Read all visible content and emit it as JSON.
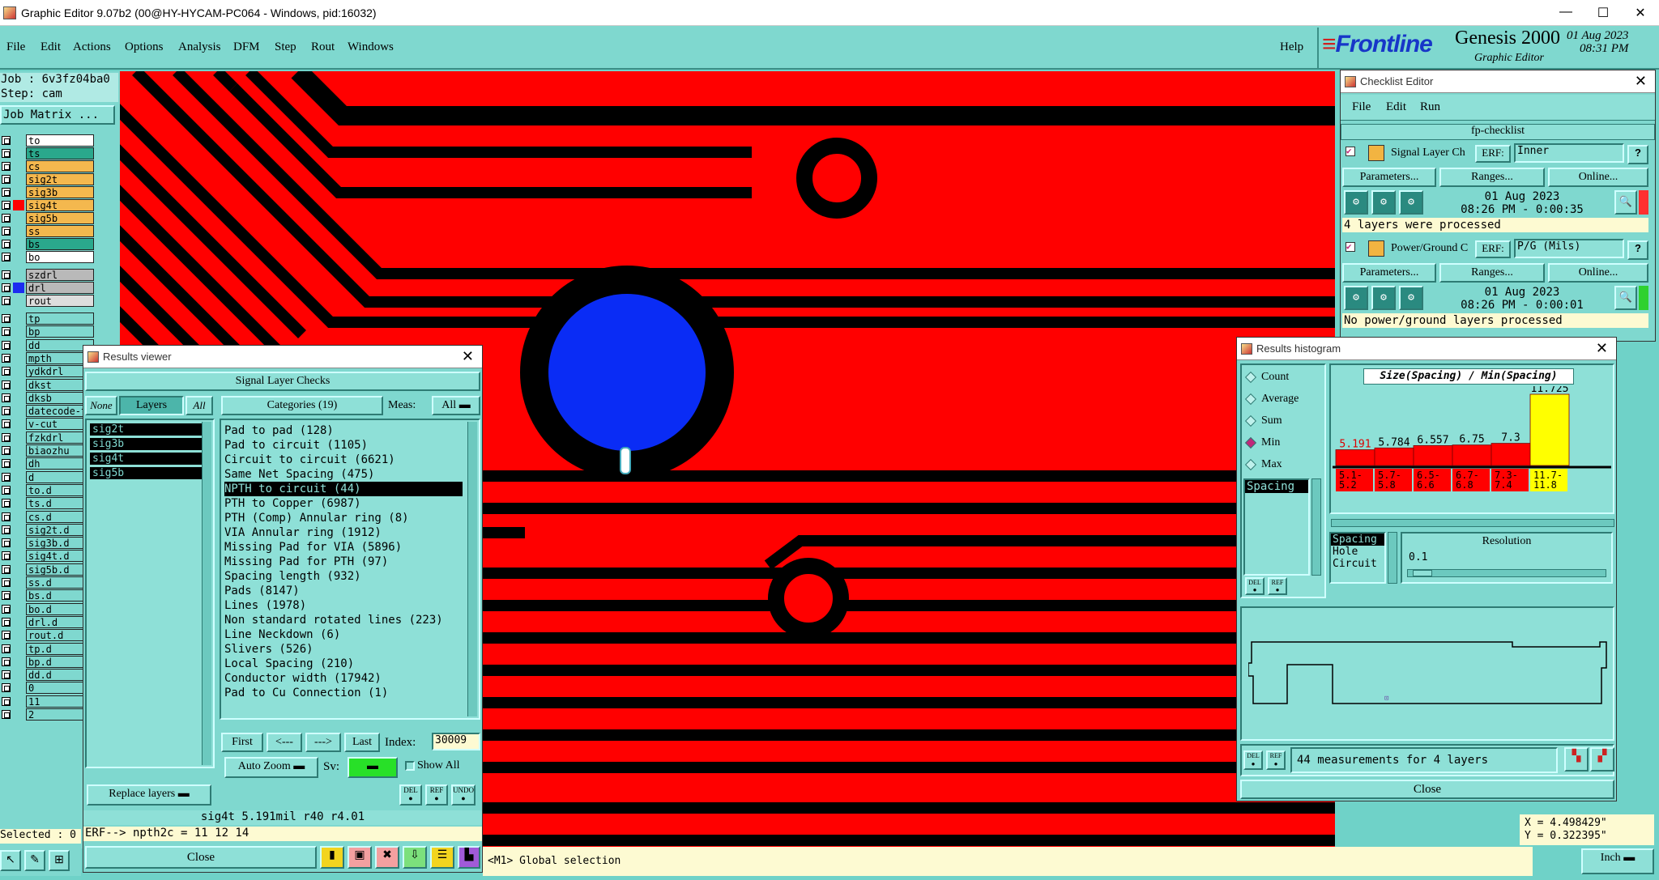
{
  "window": {
    "title": "Graphic Editor 9.07b2 (00@HY-HYCAM-PC064 - Windows, pid:16032)"
  },
  "menu": [
    "File",
    "Edit",
    "Actions",
    "Options",
    "Analysis",
    "DFM",
    "Step",
    "Rout",
    "Windows"
  ],
  "help": "Help",
  "brand": {
    "logo": "Frontline",
    "product": "Genesis 2000",
    "subtitle": "Graphic Editor",
    "date": "01 Aug 2023",
    "time": "08:31 PM"
  },
  "job": {
    "job": "Job : 6v3fz04ba0",
    "step": "Step: cam",
    "matrix": "Job Matrix ..."
  },
  "layers": [
    {
      "name": "to",
      "color": "#ffffff",
      "swatch": "#7fd8cf"
    },
    {
      "name": "ts",
      "color": "#2aa88c",
      "swatch": "#7fd8cf"
    },
    {
      "name": "cs",
      "color": "#f4b84e",
      "swatch": "#7fd8cf"
    },
    {
      "name": "sig2t",
      "color": "#f4b84e",
      "swatch": "#7fd8cf"
    },
    {
      "name": "sig3b",
      "color": "#f4b84e",
      "swatch": "#7fd8cf"
    },
    {
      "name": "sig4t",
      "color": "#f4b84e",
      "swatch": "#ff0000"
    },
    {
      "name": "sig5b",
      "color": "#f4b84e",
      "swatch": "#7fd8cf"
    },
    {
      "name": "ss",
      "color": "#f4b84e",
      "swatch": "#7fd8cf"
    },
    {
      "name": "bs",
      "color": "#2aa88c",
      "swatch": "#7fd8cf"
    },
    {
      "name": "bo",
      "color": "#ffffff",
      "swatch": "#7fd8cf"
    },
    {
      "name": "szdrl",
      "color": "#b9b9b9",
      "swatch": "#7fd8cf"
    },
    {
      "name": "drl",
      "color": "#b9b9b9",
      "swatch": "#1c2cf0"
    },
    {
      "name": "rout",
      "color": "#dddddd",
      "swatch": "#7fd8cf"
    },
    {
      "name": "tp",
      "color": "#7fd8cf",
      "swatch": "#7fd8cf"
    },
    {
      "name": "bp",
      "color": "#7fd8cf",
      "swatch": "#7fd8cf"
    },
    {
      "name": "dd",
      "color": "#7fd8cf",
      "swatch": "#7fd8cf"
    },
    {
      "name": "mpth",
      "color": "#7fd8cf",
      "swatch": "#7fd8cf"
    },
    {
      "name": "ydkdrl",
      "color": "#7fd8cf",
      "swatch": "#7fd8cf"
    },
    {
      "name": "dkst",
      "color": "#7fd8cf",
      "swatch": "#7fd8cf"
    },
    {
      "name": "dksb",
      "color": "#7fd8cf",
      "swatch": "#7fd8cf"
    },
    {
      "name": "datecode-t",
      "color": "#7fd8cf",
      "swatch": "#7fd8cf"
    },
    {
      "name": "v-cut",
      "color": "#7fd8cf",
      "swatch": "#7fd8cf"
    },
    {
      "name": "fzkdrl",
      "color": "#7fd8cf",
      "swatch": "#7fd8cf"
    },
    {
      "name": "biaozhu",
      "color": "#7fd8cf",
      "swatch": "#7fd8cf"
    },
    {
      "name": "dh",
      "color": "#7fd8cf",
      "swatch": "#7fd8cf"
    },
    {
      "name": "d",
      "color": "#7fd8cf",
      "swatch": "#7fd8cf"
    },
    {
      "name": "to.d",
      "color": "#7fd8cf",
      "swatch": "#7fd8cf"
    },
    {
      "name": "ts.d",
      "color": "#7fd8cf",
      "swatch": "#7fd8cf"
    },
    {
      "name": "cs.d",
      "color": "#7fd8cf",
      "swatch": "#7fd8cf"
    },
    {
      "name": "sig2t.d",
      "color": "#7fd8cf",
      "swatch": "#7fd8cf"
    },
    {
      "name": "sig3b.d",
      "color": "#7fd8cf",
      "swatch": "#7fd8cf"
    },
    {
      "name": "sig4t.d",
      "color": "#7fd8cf",
      "swatch": "#7fd8cf"
    },
    {
      "name": "sig5b.d",
      "color": "#7fd8cf",
      "swatch": "#7fd8cf"
    },
    {
      "name": "ss.d",
      "color": "#7fd8cf",
      "swatch": "#7fd8cf"
    },
    {
      "name": "bs.d",
      "color": "#7fd8cf",
      "swatch": "#7fd8cf"
    },
    {
      "name": "bo.d",
      "color": "#7fd8cf",
      "swatch": "#7fd8cf"
    },
    {
      "name": "drl.d",
      "color": "#7fd8cf",
      "swatch": "#7fd8cf"
    },
    {
      "name": "rout.d",
      "color": "#7fd8cf",
      "swatch": "#7fd8cf"
    },
    {
      "name": "tp.d",
      "color": "#7fd8cf",
      "swatch": "#7fd8cf"
    },
    {
      "name": "bp.d",
      "color": "#7fd8cf",
      "swatch": "#7fd8cf"
    },
    {
      "name": "dd.d",
      "color": "#7fd8cf",
      "swatch": "#7fd8cf"
    },
    {
      "name": "0",
      "color": "#7fd8cf",
      "swatch": "#7fd8cf"
    },
    {
      "name": "11",
      "color": "#7fd8cf",
      "swatch": "#7fd8cf"
    },
    {
      "name": "2",
      "color": "#7fd8cf",
      "swatch": "#7fd8cf"
    }
  ],
  "selected": "Selected : 0",
  "results_viewer": {
    "title": "Results viewer",
    "header": "Signal Layer Checks",
    "none": "None",
    "layers": "Layers",
    "all": "All",
    "categories_btn": "Categories (19)",
    "meas_label": "Meas:",
    "meas_value": "All",
    "layer_list": [
      "sig2t",
      "sig3b",
      "sig4t",
      "sig5b"
    ],
    "categories": [
      "Pad to pad (128)",
      "Pad to circuit (1105)",
      "Circuit to circuit (6621)",
      "Same Net Spacing (475)",
      "NPTH to circuit (44)",
      "PTH to Copper (6987)",
      "PTH (Comp) Annular ring (8)",
      "VIA Annular ring (1912)",
      "Missing Pad for VIA (5896)",
      "Missing Pad for PTH (97)",
      "Spacing length (932)",
      "Pads (8147)",
      "Lines (1978)",
      "Non standard rotated lines (223)",
      "Line Neckdown (6)",
      "Slivers (526)",
      "Local Spacing (210)",
      "Conductor width (17942)",
      "Pad to Cu Connection (1)"
    ],
    "selected_category": 4,
    "first": "First",
    "prev": "<---",
    "next": "--->",
    "last": "Last",
    "index_label": "Index:",
    "index_value": "30009",
    "auto_zoom": "Auto Zoom",
    "sv_label": "Sv:",
    "show_all": "Show All",
    "replace_layers": "Replace layers",
    "del": "DEL",
    "ref": "REF",
    "undo": "UNDO",
    "info": "sig4t 5.191mil  r40  r4.01",
    "erf": "ERF--> npth2c = 11 12 14",
    "close": "Close"
  },
  "checklist_editor": {
    "title": "Checklist Editor",
    "menu": [
      "File",
      "Edit",
      "Run"
    ],
    "name": "fp-checklist",
    "checks": [
      {
        "title": "Signal Layer Ch",
        "erf": "ERF:",
        "erf_value": "Inner",
        "date": "01 Aug 2023",
        "time": "08:26 PM - 0:00:35",
        "status": "4 layers were processed",
        "status_color": "#ff3030"
      },
      {
        "title": "Power/Ground C",
        "erf": "ERF:",
        "erf_value": "P/G (Mils)",
        "date": "01 Aug 2023",
        "time": "08:26 PM - 0:00:01",
        "status": "No power/ground layers processed",
        "status_color": "#2fd12f"
      }
    ],
    "parameters": "Parameters...",
    "ranges": "Ranges...",
    "online": "Online..."
  },
  "histogram": {
    "title": "Results histogram",
    "modes": [
      "Count",
      "Average",
      "Sum",
      "Min",
      "Max"
    ],
    "selected_mode": "Min",
    "list": [
      "Spacing"
    ],
    "sublist": [
      "Spacing",
      "Hole",
      "Circuit"
    ],
    "resolution_label": "Resolution",
    "resolution_value": "0.1",
    "summary": "44 measurements for 4 layers",
    "close": "Close",
    "del": "DEL",
    "ref": "REF"
  },
  "chart_data": {
    "type": "bar",
    "title": "Size(Spacing) / Min(Spacing)",
    "categories": [
      "5.1-5.2",
      "5.7-5.8",
      "6.5-6.6",
      "6.7-6.8",
      "7.3-7.4",
      "11.7-11.8"
    ],
    "category_lines": [
      [
        "5.1-",
        "5.2"
      ],
      [
        "5.7-",
        "5.8"
      ],
      [
        "6.5-",
        "6.6"
      ],
      [
        "6.7-",
        "6.8"
      ],
      [
        "7.3-",
        "7.4"
      ],
      [
        "11.7-",
        "11.8"
      ]
    ],
    "values": [
      5.191,
      5.784,
      6.557,
      6.75,
      7.3,
      11.725
    ],
    "labels": [
      "5.191",
      "5.784",
      "6.557",
      "6.75",
      "7.3",
      "11.725"
    ],
    "colors": [
      "#ff0000",
      "#ff0000",
      "#ff0000",
      "#ff0000",
      "#ff0000",
      "#ffff00"
    ],
    "ylim": [
      0,
      11.725
    ]
  },
  "coords": {
    "x": "X = 4.498429\"",
    "y": "Y = 0.322395\""
  },
  "status": "<M1> Global selection",
  "units": "Inch"
}
